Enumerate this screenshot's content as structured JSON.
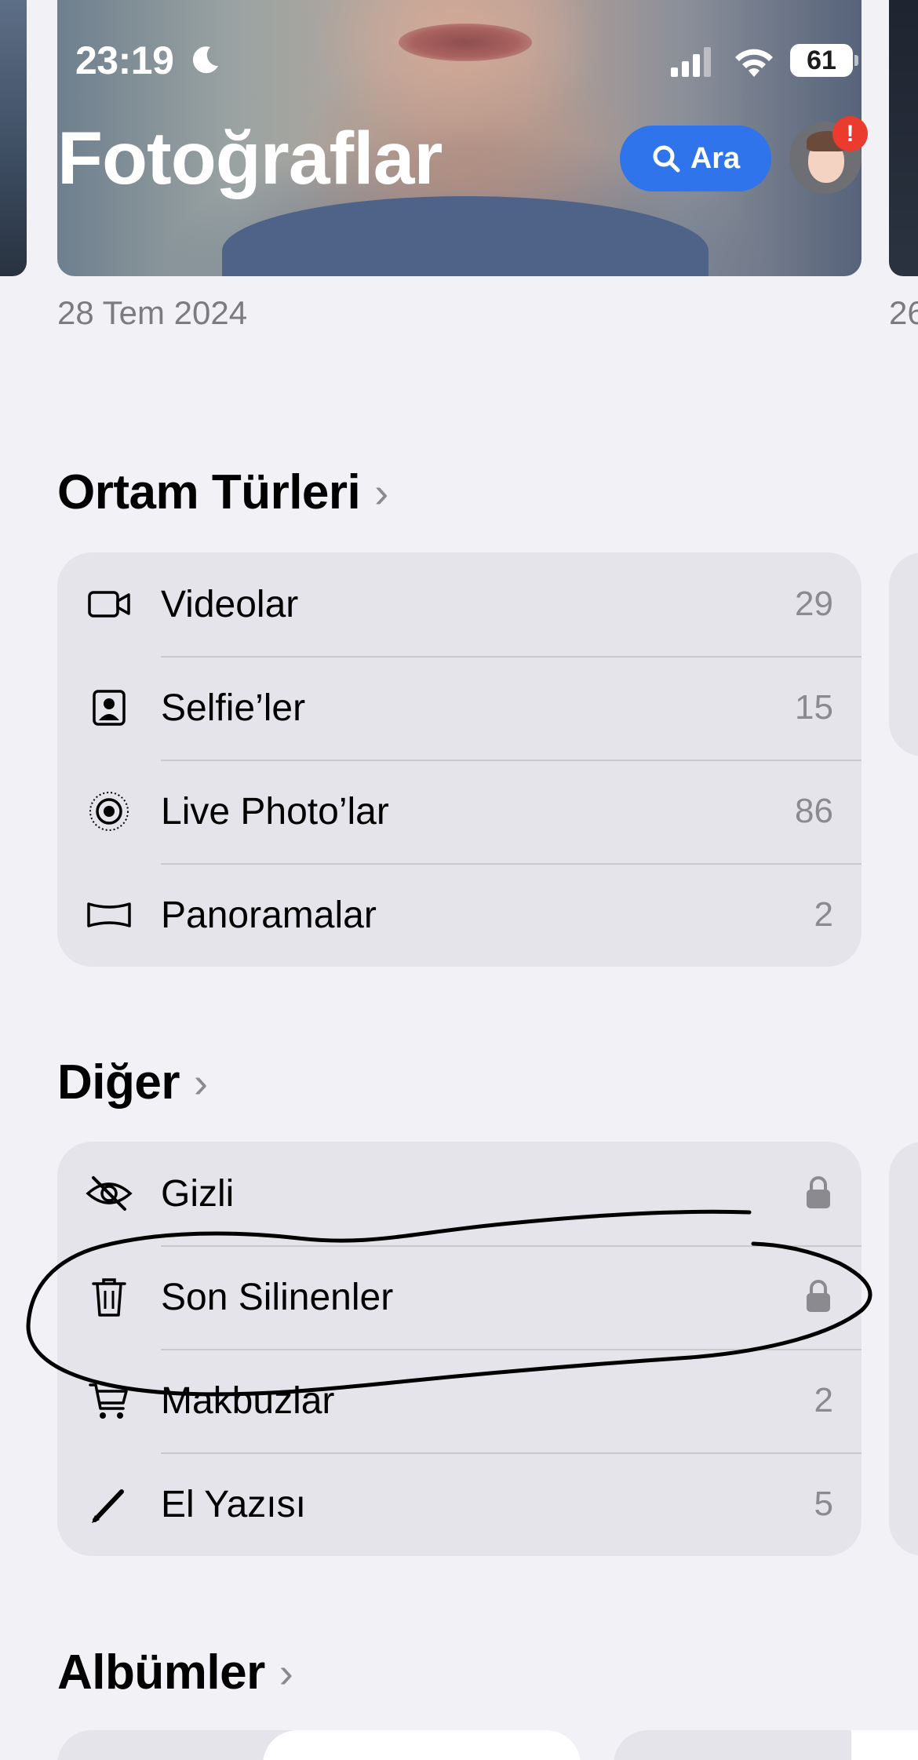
{
  "status_bar": {
    "time": "23:19",
    "battery": "61",
    "icons": [
      "moon-icon",
      "cellular-signal-icon",
      "wifi-icon",
      "battery-icon"
    ]
  },
  "header": {
    "title": "Fotoğraflar",
    "search_label": "Ara",
    "alert_badge": "!"
  },
  "hero": {
    "date": "28 Tem 2024",
    "next_date_peek": "26"
  },
  "media_types": {
    "title": "Ortam Türleri",
    "chevron": "›",
    "items": [
      {
        "icon": "video-camera-icon",
        "label": "Videolar",
        "count": "29"
      },
      {
        "icon": "selfie-portrait-icon",
        "label": "Selfie’ler",
        "count": "15"
      },
      {
        "icon": "live-photo-icon",
        "label": "Live Photo’lar",
        "count": "86"
      },
      {
        "icon": "panorama-icon",
        "label": "Panoramalar",
        "count": "2"
      }
    ]
  },
  "other": {
    "title": "Diğer",
    "chevron": "›",
    "items": [
      {
        "icon": "eye-slash-icon",
        "label": "Gizli",
        "locked": true
      },
      {
        "icon": "trash-icon",
        "label": "Son Silinenler",
        "locked": true
      },
      {
        "icon": "cart-icon",
        "label": "Makbuzlar",
        "count": "2"
      },
      {
        "icon": "pencil-icon",
        "label": "El Yazısı",
        "count": "5"
      }
    ]
  },
  "albums": {
    "title": "Albümler",
    "chevron": "›"
  },
  "colors": {
    "background": "#f1f1f6",
    "card": "#e4e4ea",
    "accent": "#2f74ea",
    "badge": "#ea3b2e",
    "secondary_text": "#8a8a8f"
  }
}
